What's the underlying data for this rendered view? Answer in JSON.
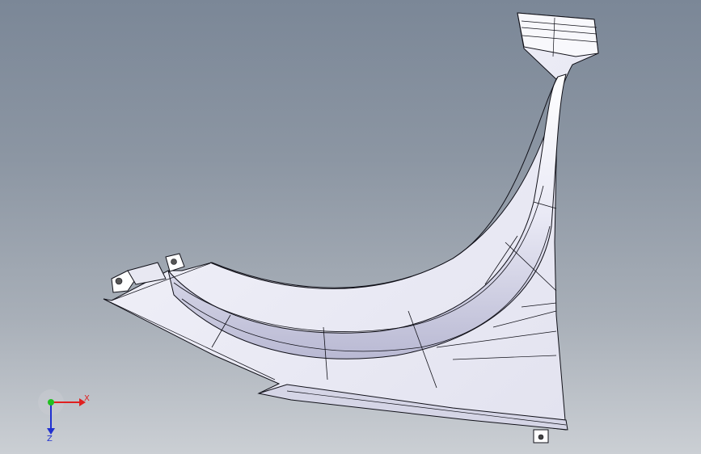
{
  "viewport": {
    "background_top": "#7b8797",
    "background_bottom": "#cbcfd4"
  },
  "triad": {
    "x_label": "X",
    "z_label": "Z",
    "colors": {
      "x": "#e02020",
      "y": "#20c020",
      "z": "#2030d0"
    }
  },
  "icons": {
    "triad": "reference-triad-icon"
  }
}
